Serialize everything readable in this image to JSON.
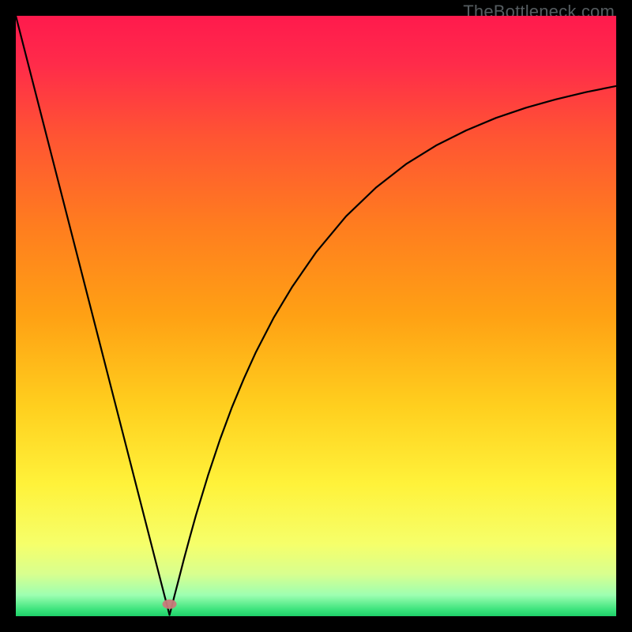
{
  "watermark": "TheBottleneck.com",
  "chart_data": {
    "type": "line",
    "title": "",
    "xlabel": "",
    "ylabel": "",
    "xlim": [
      0,
      100
    ],
    "ylim": [
      0,
      100
    ],
    "grid": false,
    "gradient_stops": [
      {
        "offset": 0.0,
        "color": "#ff1a4d"
      },
      {
        "offset": 0.08,
        "color": "#ff2b4a"
      },
      {
        "offset": 0.2,
        "color": "#ff5433"
      },
      {
        "offset": 0.35,
        "color": "#ff7d1f"
      },
      {
        "offset": 0.5,
        "color": "#ffa114"
      },
      {
        "offset": 0.65,
        "color": "#ffcf1e"
      },
      {
        "offset": 0.78,
        "color": "#fff23a"
      },
      {
        "offset": 0.88,
        "color": "#f6ff6a"
      },
      {
        "offset": 0.93,
        "color": "#d8ff8f"
      },
      {
        "offset": 0.965,
        "color": "#9dffb1"
      },
      {
        "offset": 0.99,
        "color": "#38e27a"
      },
      {
        "offset": 1.0,
        "color": "#1ecf69"
      }
    ],
    "marker": {
      "x": 25.6,
      "y": 2,
      "color": "#c97a7a"
    },
    "series": [
      {
        "name": "curve",
        "x": [
          0,
          2,
          4,
          6,
          8,
          10,
          12,
          14,
          16,
          18,
          20,
          22,
          23,
          24,
          24.8,
          25.2,
          25.6,
          26,
          26.4,
          27,
          28,
          29,
          30,
          32,
          34,
          36,
          38,
          40,
          43,
          46,
          50,
          55,
          60,
          65,
          70,
          75,
          80,
          85,
          90,
          95,
          100
        ],
        "y": [
          100,
          92.2,
          84.4,
          76.6,
          68.8,
          61,
          53.2,
          45.4,
          37.6,
          29.8,
          22,
          14.2,
          10.3,
          6.4,
          3.3,
          1.8,
          0.2,
          1.7,
          3.3,
          5.6,
          9.5,
          13.2,
          16.8,
          23.4,
          29.4,
          34.8,
          39.6,
          44,
          49.8,
          54.8,
          60.6,
          66.6,
          71.4,
          75.3,
          78.4,
          80.9,
          83,
          84.7,
          86.1,
          87.3,
          88.3
        ]
      }
    ]
  }
}
